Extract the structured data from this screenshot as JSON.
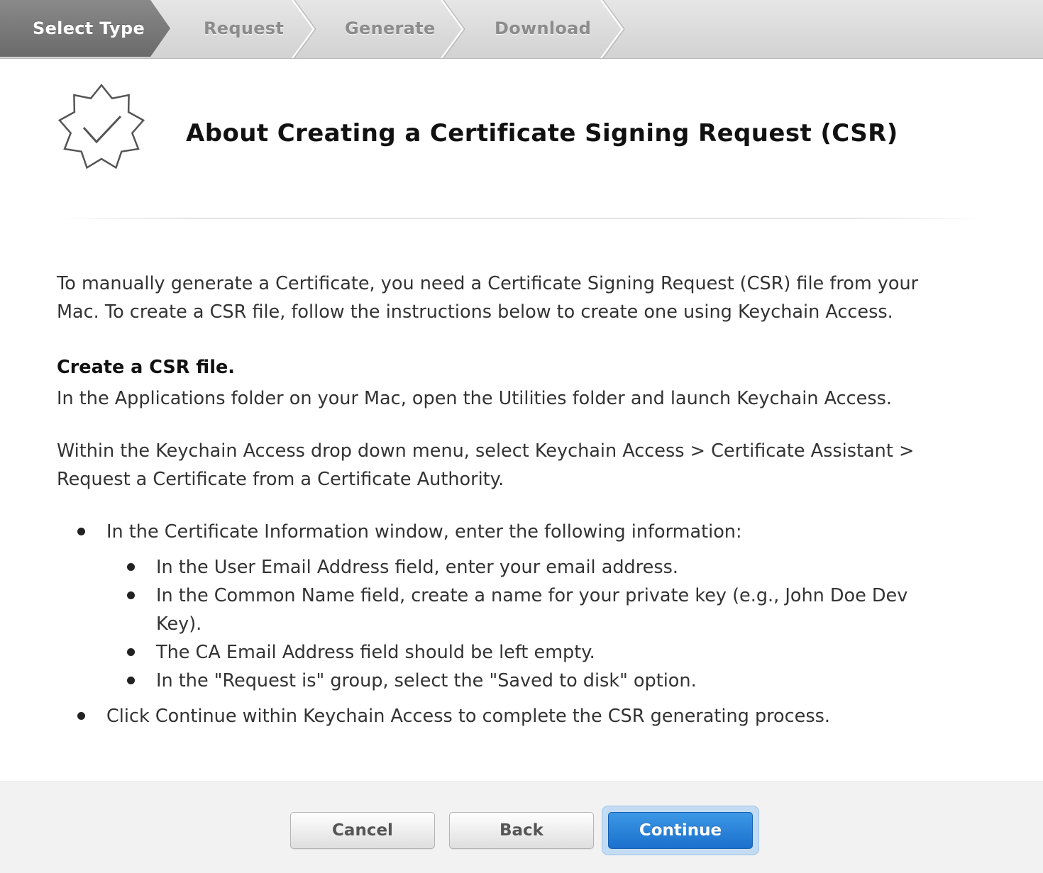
{
  "steps": [
    {
      "label": "Select Type",
      "state": "active"
    },
    {
      "label": "Request",
      "state": "inactive"
    },
    {
      "label": "Generate",
      "state": "inactive"
    },
    {
      "label": "Download",
      "state": "inactive"
    }
  ],
  "header": {
    "icon": "certificate-badge-icon",
    "title": "About Creating a Certificate Signing Request (CSR)"
  },
  "content": {
    "intro": "To manually generate a Certificate, you need a Certificate Signing Request (CSR) file from your Mac. To create a CSR file, follow the instructions below to create one using Keychain Access.",
    "subheading": "Create a CSR file.",
    "para_applications": "In the Applications folder on your Mac, open the Utilities folder and launch Keychain Access.",
    "para_menu": "Within the Keychain Access drop down menu, select Keychain Access > Certificate Assistant > Request a Certificate from a Certificate Authority.",
    "bullets": [
      "In the Certificate Information window, enter the following information:",
      "Click Continue within Keychain Access to complete the CSR generating process."
    ],
    "sub_bullets": [
      "In the User Email Address field, enter your email address.",
      "In the Common Name field, create a name for your private key (e.g., John Doe Dev",
      "Key).",
      "The CA Email Address field should be left empty.",
      "In the \"Request is\" group, select the \"Saved to disk\" option."
    ]
  },
  "footer": {
    "cancel_label": "Cancel",
    "back_label": "Back",
    "continue_label": "Continue"
  },
  "colors": {
    "primary_button": "#2a82d8",
    "active_step": "#7a7a7a",
    "inactive_step_text": "#8c8c8c"
  }
}
